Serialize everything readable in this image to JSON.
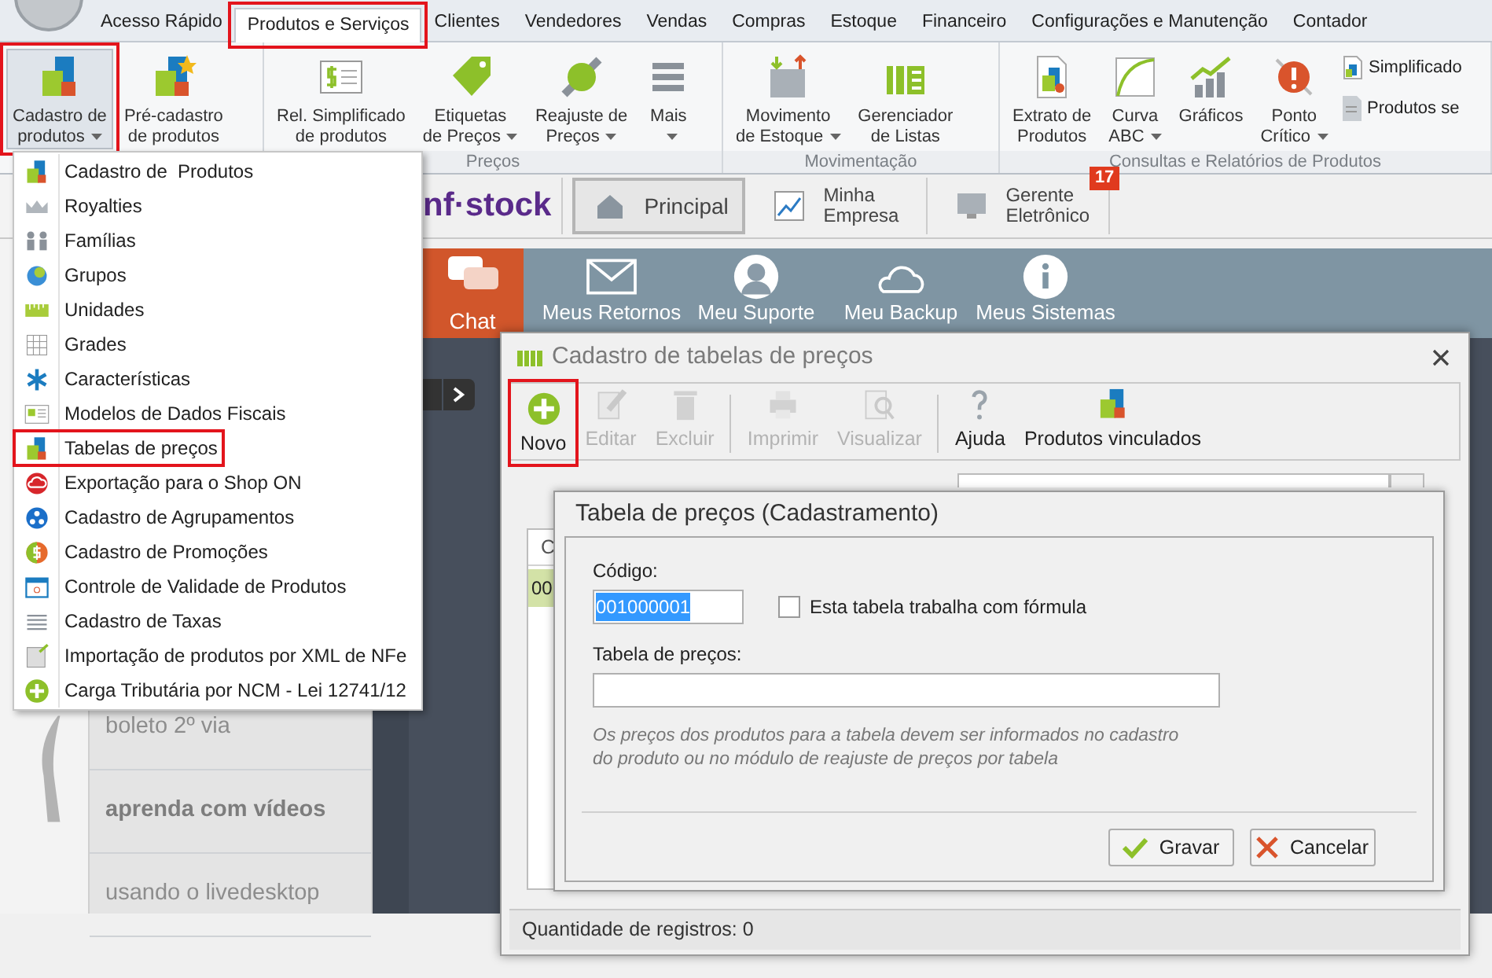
{
  "ribbon_tabs": [
    {
      "label": "Acesso Rápido",
      "selected": false,
      "highlighted": false
    },
    {
      "label": "Produtos e Serviços",
      "selected": true,
      "highlighted": true
    },
    {
      "label": "Clientes",
      "selected": false,
      "highlighted": false
    },
    {
      "label": "Vendedores",
      "selected": false,
      "highlighted": false
    },
    {
      "label": "Vendas",
      "selected": false,
      "highlighted": false
    },
    {
      "label": "Compras",
      "selected": false,
      "highlighted": false
    },
    {
      "label": "Estoque",
      "selected": false,
      "highlighted": false
    },
    {
      "label": "Financeiro",
      "selected": false,
      "highlighted": false
    },
    {
      "label": "Configurações e Manutenção",
      "selected": false,
      "highlighted": false
    },
    {
      "label": "Contador",
      "selected": false,
      "highlighted": false
    }
  ],
  "ribbon_groups": [
    {
      "items": [
        {
          "kind": "large",
          "lines": [
            "Cadastro de",
            "produtos"
          ],
          "dropdown": true,
          "highlighted": true
        },
        {
          "kind": "large",
          "lines": [
            "Pré-cadastro",
            "de produtos"
          ],
          "dropdown": false,
          "highlighted": false
        }
      ]
    },
    {
      "label": "Preços",
      "items": [
        {
          "kind": "large",
          "lines": [
            "Rel. Simplificado",
            "de produtos"
          ],
          "dropdown": false,
          "highlighted": false
        },
        {
          "kind": "large",
          "lines": [
            "Etiquetas",
            "de Preços"
          ],
          "dropdown": true,
          "highlighted": false
        },
        {
          "kind": "large",
          "lines": [
            "Reajuste de",
            "Preços"
          ],
          "dropdown": true,
          "highlighted": false
        },
        {
          "kind": "large",
          "lines": [
            "Mais"
          ],
          "dropdown": true,
          "highlighted": false
        }
      ]
    },
    {
      "label": "Movimentação",
      "items": [
        {
          "kind": "large",
          "lines": [
            "Movimento",
            "de Estoque"
          ],
          "dropdown": true,
          "highlighted": false
        },
        {
          "kind": "large",
          "lines": [
            "Gerenciador",
            "de Listas"
          ],
          "dropdown": false,
          "highlighted": false
        }
      ]
    },
    {
      "label": "Consultas e Relatórios de Produtos",
      "items": [
        {
          "kind": "large",
          "lines": [
            "Extrato de",
            "Produtos"
          ],
          "dropdown": false,
          "highlighted": false
        },
        {
          "kind": "large",
          "lines": [
            "Curva",
            "ABC"
          ],
          "dropdown": true,
          "highlighted": false
        },
        {
          "kind": "large",
          "lines": [
            "Gráficos"
          ],
          "dropdown": false,
          "highlighted": false
        },
        {
          "kind": "large",
          "lines": [
            "Ponto",
            "Crítico"
          ],
          "dropdown": true,
          "highlighted": false
        },
        {
          "kind": "small",
          "lines": [
            "Simplificado"
          ],
          "dropdown": false,
          "highlighted": false
        },
        {
          "kind": "small",
          "lines": [
            "Produtos se"
          ],
          "dropdown": false,
          "highlighted": false
        }
      ]
    }
  ],
  "logo_text": "nf·stock",
  "home_tabs": [
    {
      "lines": [
        "Principal"
      ],
      "selected": true
    },
    {
      "lines": [
        "Minha",
        "Empresa"
      ],
      "selected": false
    },
    {
      "lines": [
        "Gerente",
        "Eletrônico"
      ],
      "selected": false,
      "badge": "17"
    }
  ],
  "sidebar_links": [
    {
      "label": "boleto 2º via",
      "bold": false
    },
    {
      "label": "aprenda com vídeos",
      "bold": true
    },
    {
      "label": "usando o livedesktop",
      "bold": false
    }
  ],
  "chat_tile": "Chat",
  "nav_tiles": [
    "Meus Retornos",
    "Meu Suporte",
    "Meu Backup",
    "Meus Sistemas"
  ],
  "menu_items": [
    {
      "label": "Cadastro de  Produtos",
      "highlighted": false
    },
    {
      "label": "Royalties",
      "highlighted": false
    },
    {
      "label": "Famílias",
      "highlighted": false
    },
    {
      "label": "Grupos",
      "highlighted": false
    },
    {
      "label": "Unidades",
      "highlighted": false
    },
    {
      "label": "Grades",
      "highlighted": false
    },
    {
      "label": "Características",
      "highlighted": false
    },
    {
      "label": "Modelos de Dados Fiscais",
      "highlighted": false
    },
    {
      "label": "Tabelas de preços",
      "highlighted": true
    },
    {
      "label": "Exportação para o Shop ON",
      "highlighted": false
    },
    {
      "label": "Cadastro de Agrupamentos",
      "highlighted": false
    },
    {
      "label": "Cadastro de Promoções",
      "highlighted": false
    },
    {
      "label": "Controle de Validade de Produtos",
      "highlighted": false
    },
    {
      "label": "Cadastro de Taxas",
      "highlighted": false
    },
    {
      "label": "Importação de produtos por XML de NFe",
      "highlighted": false
    },
    {
      "label": "Carga Tributária por NCM - Lei 12741/12",
      "highlighted": false
    }
  ],
  "dialog": {
    "title": "Cadastro de tabelas de preços",
    "toolbar": [
      {
        "label": "Novo",
        "disabled": false,
        "highlighted": true
      },
      {
        "label": "Editar",
        "disabled": true,
        "highlighted": false
      },
      {
        "label": "Excluir",
        "disabled": true,
        "highlighted": false
      },
      {
        "label": "Imprimir",
        "disabled": true,
        "highlighted": false
      },
      {
        "label": "Visualizar",
        "disabled": true,
        "highlighted": false
      },
      {
        "label": "Ajuda",
        "disabled": false,
        "highlighted": false
      },
      {
        "label": "Produtos vinculados",
        "disabled": false,
        "highlighted": false
      }
    ],
    "table": {
      "columns": [
        "C"
      ],
      "rows": [
        {
          "cells": [
            "00"
          ],
          "selected": true
        }
      ]
    },
    "status_bar": "Quantidade de registros: 0"
  },
  "form": {
    "title": "Tabela de preços (Cadastramento)",
    "code_label": "Código:",
    "code_value": "001000001",
    "code_value_selected": true,
    "formula_checkbox": {
      "label": "Esta tabela trabalha com fórmula",
      "checked": false
    },
    "name_label": "Tabela de preços:",
    "note": "Os preços dos produtos para a tabela devem ser informados no cadastro do produto ou no módulo de reajuste de preços por tabela",
    "buttons": [
      {
        "label": "Gravar",
        "kind": "confirm"
      },
      {
        "label": "Cancelar",
        "kind": "cancel"
      }
    ]
  }
}
